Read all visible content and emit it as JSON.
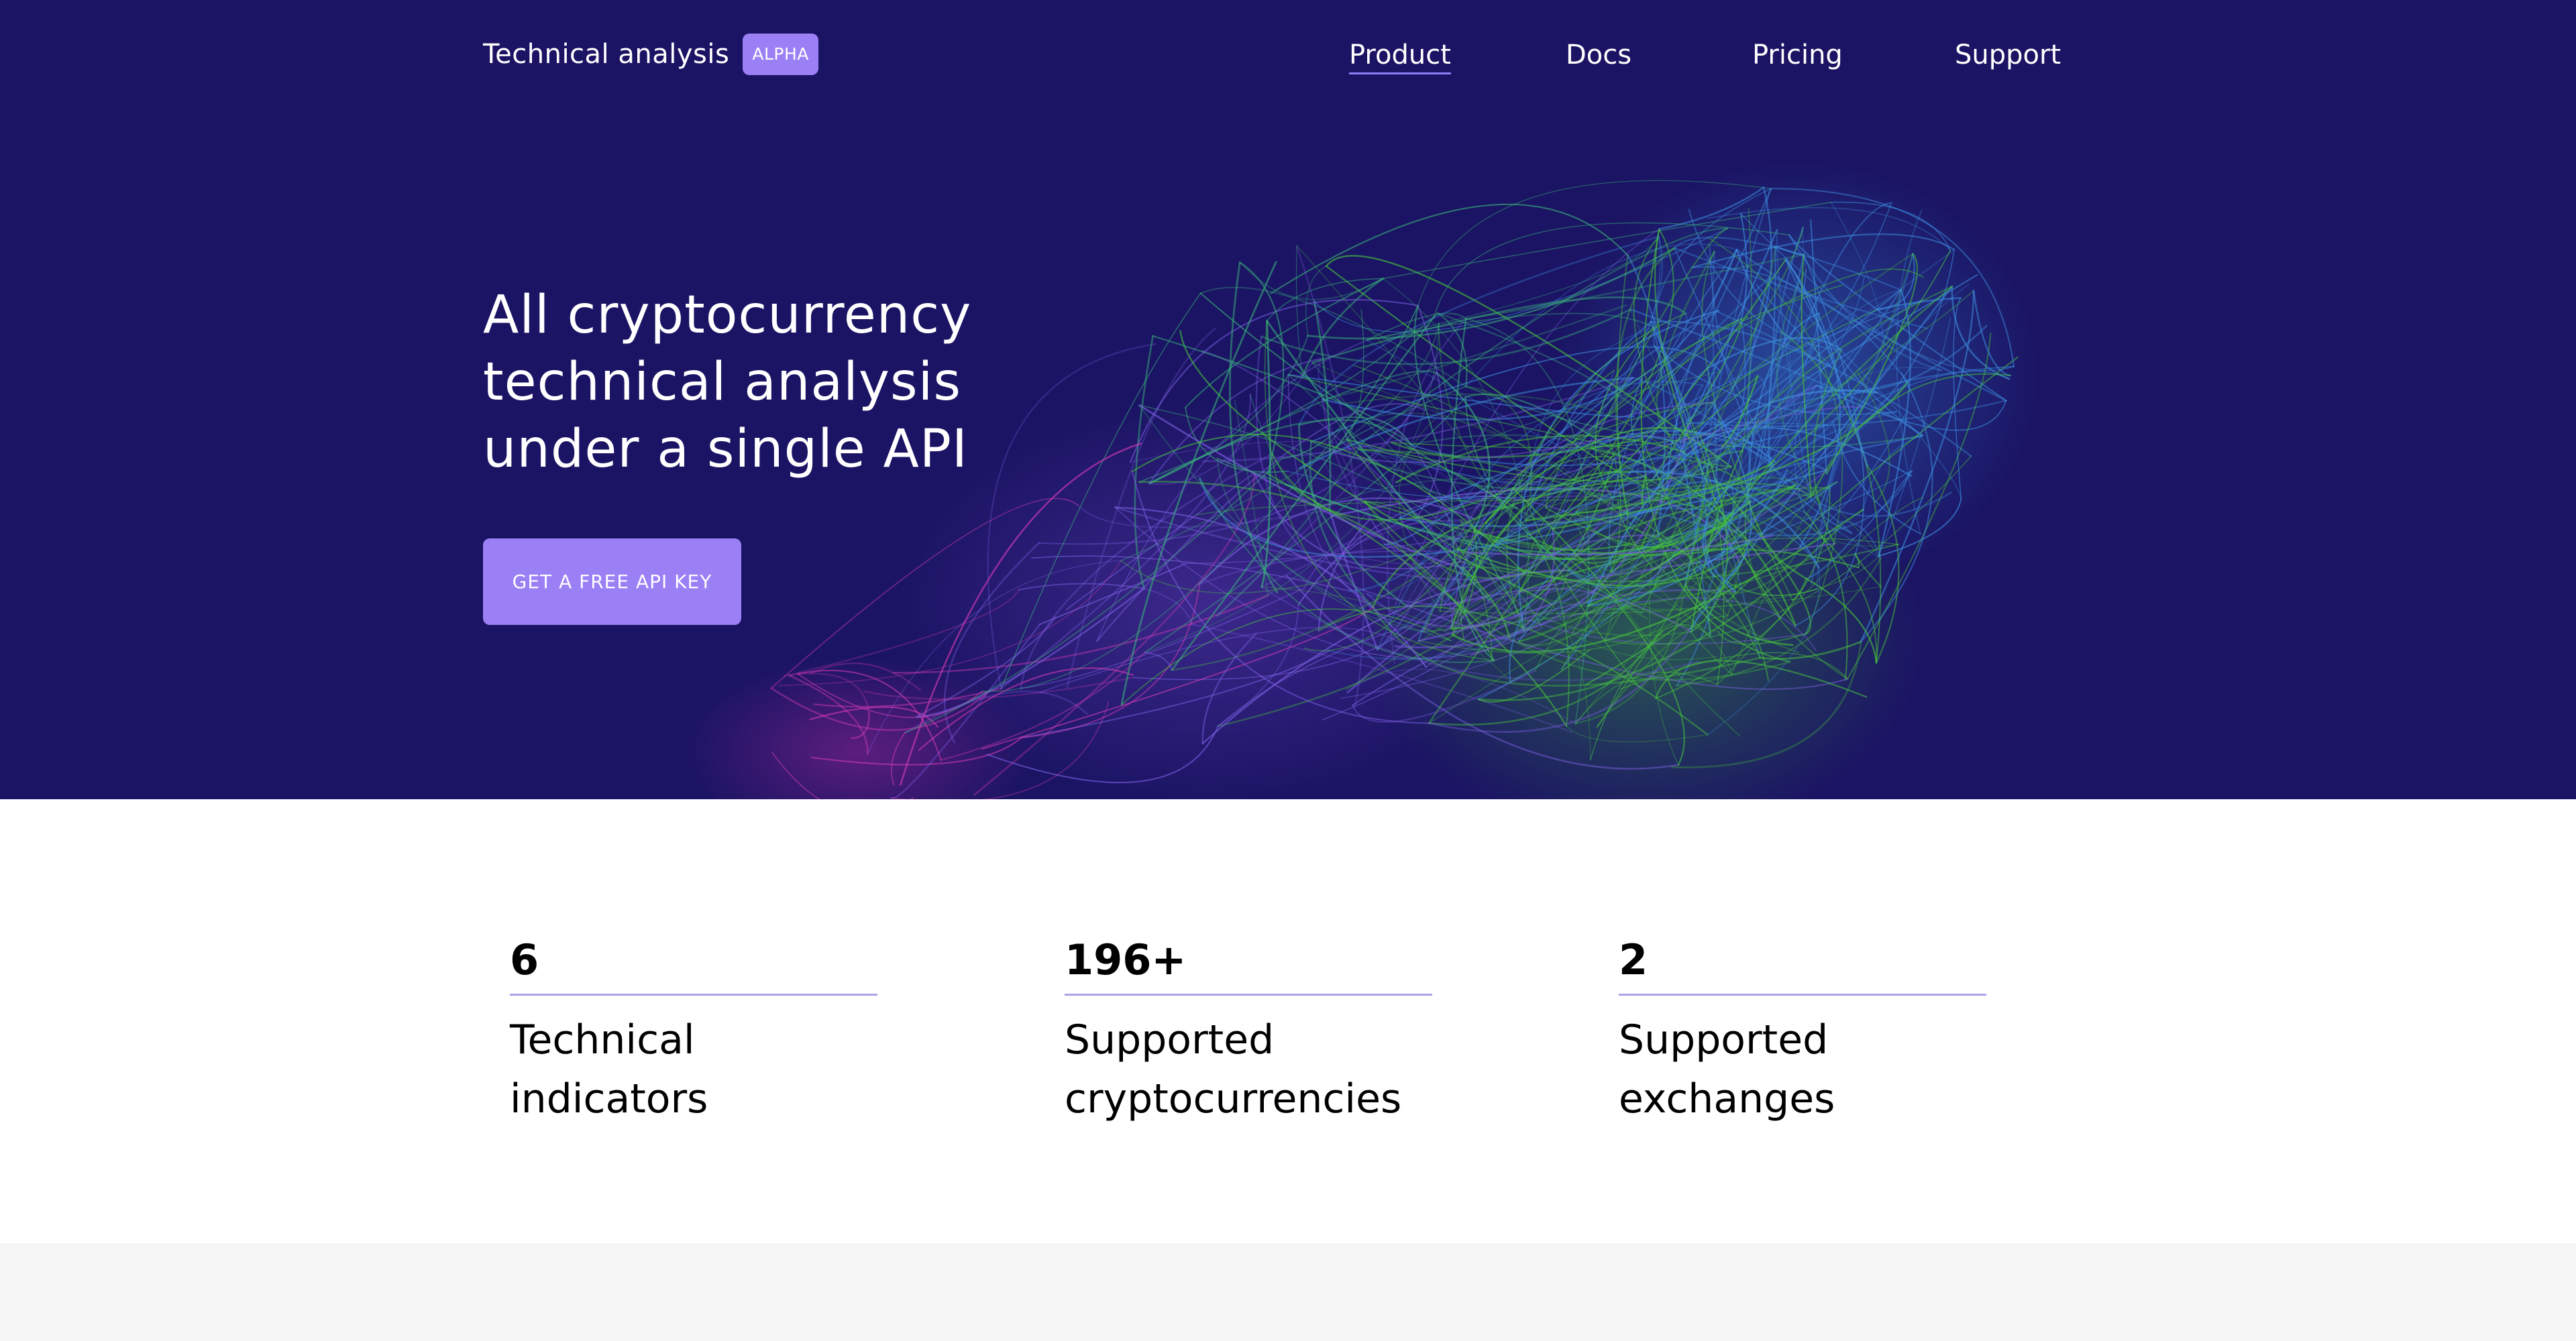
{
  "brand": {
    "name": "Technical analysis",
    "badge": "ALPHA"
  },
  "nav": {
    "items": [
      {
        "label": "Product",
        "active": true
      },
      {
        "label": "Docs",
        "active": false
      },
      {
        "label": "Pricing",
        "active": false
      },
      {
        "label": "Support",
        "active": false
      }
    ]
  },
  "hero": {
    "headline_lines": [
      "All cryptocurrency",
      "technical analysis",
      "under a single API"
    ],
    "cta_label": "GET A FREE API KEY",
    "background_color": "#1b1464",
    "accent_color": "#9b7ff5"
  },
  "stats": [
    {
      "value": "6",
      "label": "Technical indicators"
    },
    {
      "value": "196+",
      "label": "Supported cryptocurrencies"
    },
    {
      "value": "2",
      "label": "Supported exchanges"
    }
  ]
}
